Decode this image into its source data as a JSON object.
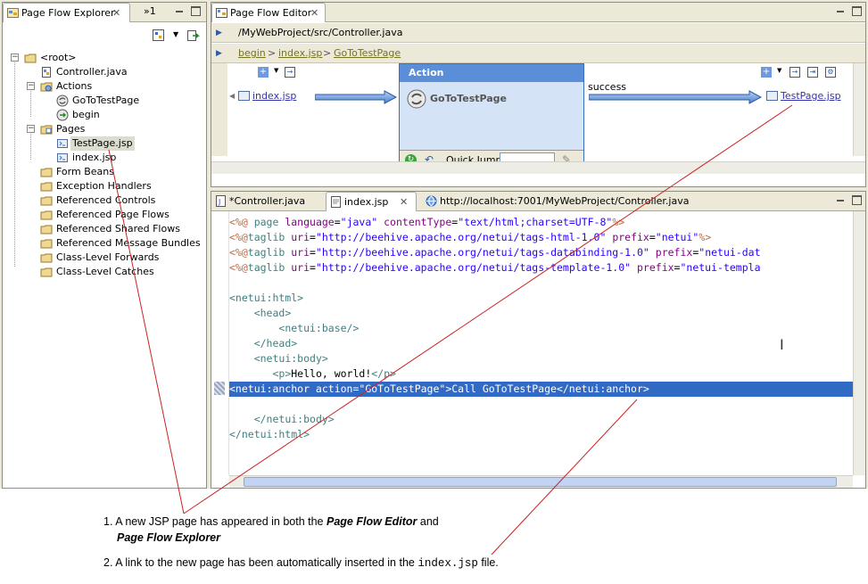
{
  "explorer": {
    "tab_label": "Page Flow Explorer",
    "overflow_label": "»1",
    "tree": [
      {
        "label": "<root>",
        "icon": "root-folder-icon",
        "depth": 0,
        "expanded": true
      },
      {
        "label": "Controller.java",
        "icon": "java-file-icon",
        "depth": 1
      },
      {
        "label": "Actions",
        "icon": "actions-folder-icon",
        "depth": 1,
        "expanded": true
      },
      {
        "label": "GoToTestPage",
        "icon": "action-icon",
        "depth": 2
      },
      {
        "label": "begin",
        "icon": "action-begin-icon",
        "depth": 2
      },
      {
        "label": "Pages",
        "icon": "pages-folder-icon",
        "depth": 1,
        "expanded": true
      },
      {
        "label": "TestPage.jsp",
        "icon": "jsp-file-icon",
        "depth": 2,
        "selected": true
      },
      {
        "label": "index.jsp",
        "icon": "jsp-file-icon",
        "depth": 2
      },
      {
        "label": "Form Beans",
        "icon": "folder-icon",
        "depth": 1
      },
      {
        "label": "Exception Handlers",
        "icon": "folder-icon",
        "depth": 1
      },
      {
        "label": "Referenced Controls",
        "icon": "folder-icon",
        "depth": 1
      },
      {
        "label": "Referenced Page Flows",
        "icon": "folder-icon",
        "depth": 1
      },
      {
        "label": "Referenced Shared Flows",
        "icon": "folder-icon",
        "depth": 1
      },
      {
        "label": "Referenced Message Bundles",
        "icon": "folder-icon",
        "depth": 1
      },
      {
        "label": "Class-Level Forwards",
        "icon": "folder-icon",
        "depth": 1
      },
      {
        "label": "Class-Level Catches",
        "icon": "folder-icon",
        "depth": 1
      }
    ]
  },
  "editor": {
    "tab_label": "Page Flow Editor",
    "path": "/MyWebProject/src/Controller.java",
    "breadcrumb": [
      "begin",
      "index.jsp",
      "GoToTestPage"
    ],
    "breadcrumb_sep": ">",
    "left_page": "index.jsp",
    "action_header": "Action",
    "action_name": "GoToTestPage",
    "quick_jump_label": "Quick Jump",
    "forward_label": "success",
    "right_page": "TestPage.jsp"
  },
  "source": {
    "tabs": [
      {
        "label": "*Controller.java",
        "icon": "java-file-icon"
      },
      {
        "label": "index.jsp",
        "icon": "jsp-file-icon",
        "active": true
      },
      {
        "label": "http://localhost:7001/MyWebProject/Controller.java",
        "icon": "globe-icon"
      }
    ],
    "lines": [
      [
        [
          "c-delim",
          "<%@ "
        ],
        [
          "c-tag",
          "page "
        ],
        [
          "c-attr",
          "language"
        ],
        [
          "c-txt",
          "="
        ],
        [
          "c-val",
          "\"java\" "
        ],
        [
          "c-attr",
          "contentType"
        ],
        [
          "c-txt",
          "="
        ],
        [
          "c-val",
          "\"text/html;charset=UTF-8\""
        ],
        [
          "c-delim",
          "%>"
        ]
      ],
      [
        [
          "c-delim",
          "<%@"
        ],
        [
          "c-tag",
          "taglib "
        ],
        [
          "c-attr",
          "uri"
        ],
        [
          "c-txt",
          "="
        ],
        [
          "c-val",
          "\"http://beehive.apache.org/netui/tags-html-1.0\" "
        ],
        [
          "c-attr",
          "prefix"
        ],
        [
          "c-txt",
          "="
        ],
        [
          "c-val",
          "\"netui\""
        ],
        [
          "c-delim",
          "%>"
        ]
      ],
      [
        [
          "c-delim",
          "<%@"
        ],
        [
          "c-tag",
          "taglib "
        ],
        [
          "c-attr",
          "uri"
        ],
        [
          "c-txt",
          "="
        ],
        [
          "c-val",
          "\"http://beehive.apache.org/netui/tags-databinding-1.0\" "
        ],
        [
          "c-attr",
          "prefix"
        ],
        [
          "c-txt",
          "="
        ],
        [
          "c-val",
          "\"netui-dat"
        ]
      ],
      [
        [
          "c-delim",
          "<%@"
        ],
        [
          "c-tag",
          "taglib "
        ],
        [
          "c-attr",
          "uri"
        ],
        [
          "c-txt",
          "="
        ],
        [
          "c-val",
          "\"http://beehive.apache.org/netui/tags-template-1.0\" "
        ],
        [
          "c-attr",
          "prefix"
        ],
        [
          "c-txt",
          "="
        ],
        [
          "c-val",
          "\"netui-templa"
        ]
      ],
      [],
      [
        [
          "c-tag",
          "<netui:html>"
        ]
      ],
      [
        [
          "c-txt",
          "    "
        ],
        [
          "c-tag",
          "<head>"
        ]
      ],
      [
        [
          "c-txt",
          "        "
        ],
        [
          "c-tag",
          "<netui:base/>"
        ]
      ],
      [
        [
          "c-txt",
          "    "
        ],
        [
          "c-tag",
          "</head>"
        ]
      ],
      [
        [
          "c-txt",
          "    "
        ],
        [
          "c-tag",
          "<netui:body>"
        ]
      ],
      [
        [
          "c-txt",
          "       "
        ],
        [
          "c-tag",
          "<p>"
        ],
        [
          "c-txt",
          "Hello, world!"
        ],
        [
          "c-tag",
          "</p>"
        ]
      ],
      [
        [
          "c-hl",
          "<netui:anchor action=\"GoToTestPage\">Call GoToTestPage</netui:anchor>"
        ]
      ],
      [],
      [
        [
          "c-txt",
          "    "
        ],
        [
          "c-tag",
          "</netui:body>"
        ]
      ],
      [
        [
          "c-tag",
          "</netui:html>"
        ]
      ]
    ]
  },
  "notes": {
    "item1_a": "A new JSP page has appeared in both the ",
    "item1_b": "Page Flow Editor",
    "item1_c": " and",
    "item1_d": "Page Flow Explorer",
    "item2_a": "A link to the new page has been automatically inserted in the ",
    "item2_b": "index.jsp",
    "item2_c": " file."
  },
  "colors": {
    "selection": "#316ac5",
    "callout_line": "#cc2222",
    "action_header": "#5b8ed8"
  }
}
